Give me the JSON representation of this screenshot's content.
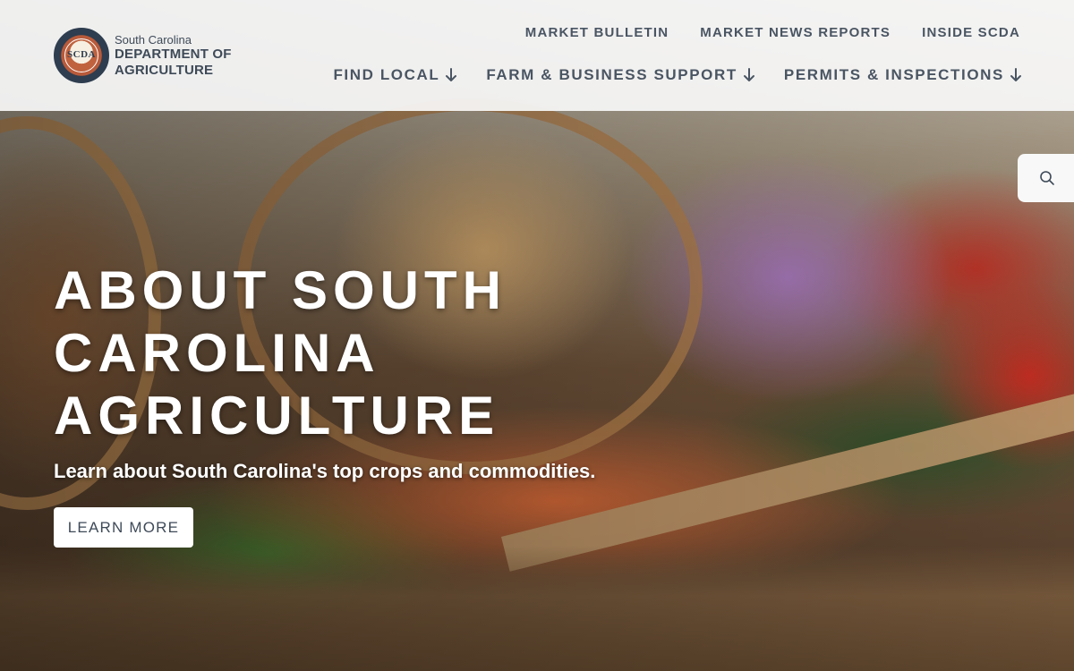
{
  "logo": {
    "seal_text": "SCDA",
    "line1": "South Carolina",
    "line2": "DEPARTMENT OF AGRICULTURE"
  },
  "top_nav": [
    {
      "label": "MARKET BULLETIN"
    },
    {
      "label": "MARKET NEWS REPORTS"
    },
    {
      "label": "INSIDE SCDA"
    }
  ],
  "main_nav": [
    {
      "label": "FIND LOCAL"
    },
    {
      "label": "FARM & BUSINESS SUPPORT"
    },
    {
      "label": "PERMITS & INSPECTIONS"
    }
  ],
  "hero": {
    "title": "ABOUT SOUTH CAROLINA AGRICULTURE",
    "subtitle": "Learn about South Carolina's top crops and commodities.",
    "button_label": "LEARN MORE"
  },
  "icons": {
    "search": "search-icon",
    "dropdown": "arrow-down-icon"
  },
  "colors": {
    "header_bg": "#f8f8f8",
    "nav_text": "#4a5563",
    "hero_text": "#ffffff"
  }
}
